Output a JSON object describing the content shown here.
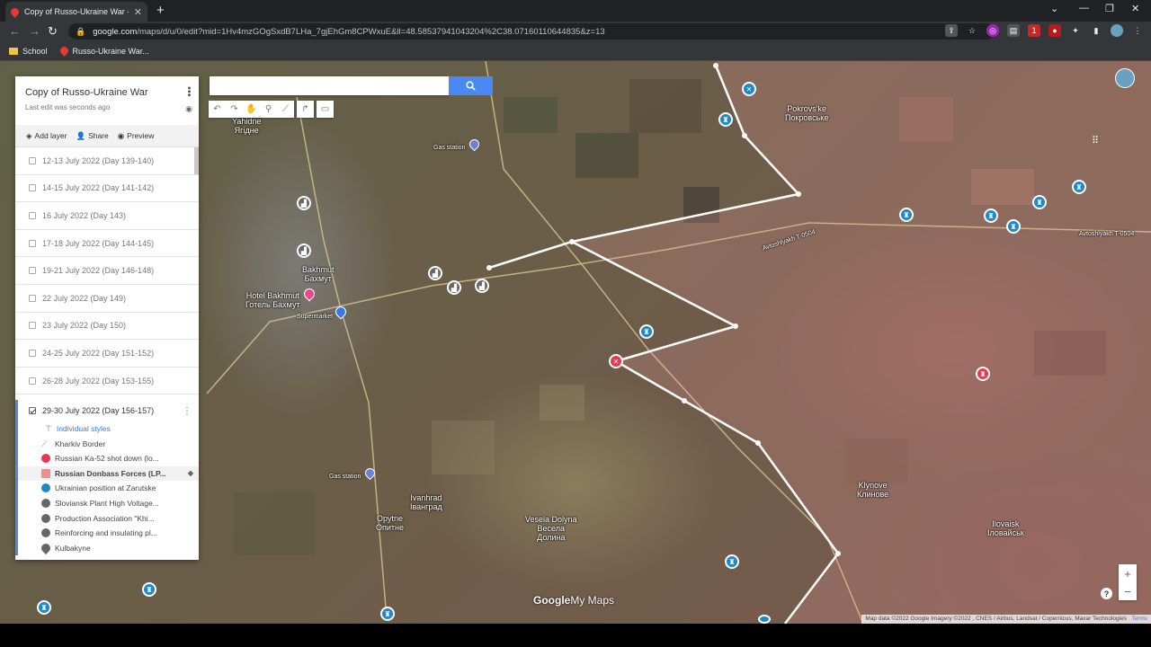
{
  "browser": {
    "tab_title": "Copy of Russo-Ukraine War - Go",
    "url_host": "google.com",
    "url_rest": "/maps/d/u/0/edit?mid=1Hv4mzGOgSxdB7LHa_7gjEhGm8CPWxuE&ll=48.58537941043204%2C38.07160110644835&z=13",
    "bookmarks": [
      "School",
      "Russo-Ukraine War..."
    ],
    "extension_badge": "1"
  },
  "panel": {
    "title": "Copy of Russo-Ukraine War",
    "subtitle": "Last edit was seconds ago",
    "actions": {
      "add_layer": "Add layer",
      "share": "Share",
      "preview": "Preview"
    },
    "layers": [
      "12-13 July 2022 (Day 139-140)",
      "14-15 July 2022 (Day 141-142)",
      "16 July 2022 (Day 143)",
      "17-18 July 2022 (Day 144-145)",
      "19-21 July 2022 (Day 146-148)",
      "22 July 2022 (Day 149)",
      "23 July 2022 (Day 150)",
      "24-25 July 2022 (Day 151-152)",
      "26-28 July 2022 (Day 153-155)"
    ],
    "active_layer": "29-30 July 2022 (Day 156-157)",
    "style_link": "Individual styles",
    "features": [
      {
        "label": "Kharkiv Border",
        "icon": "line-icon",
        "color": "#8a8a8a"
      },
      {
        "label": "Russian Ka-52 shot down (lo...",
        "icon": "crossed-circle-icon",
        "color": "#e53950"
      },
      {
        "label": "Russian Donbass Forces (LP...",
        "icon": "polygon-icon",
        "color": "#e89090"
      },
      {
        "label": "Ukrainian position at Zarutske",
        "icon": "fort-icon",
        "color": "#1e88c8"
      },
      {
        "label": "Sloviansk Plant High Voltage...",
        "icon": "factory-icon",
        "color": "#666666"
      },
      {
        "label": "Production Association \"Khi...",
        "icon": "factory-icon",
        "color": "#666666"
      },
      {
        "label": "Reinforcing and insulating pl...",
        "icon": "factory-icon",
        "color": "#666666"
      },
      {
        "label": "Kulbakyne",
        "icon": "pin-icon",
        "color": "#666666"
      }
    ]
  },
  "map": {
    "labels": {
      "yahidne": "Yahidne\nЯгідне",
      "bakhmut": "Bakhmut\nБахмут",
      "hotel": "Hotel Bakhmut\nГотель Бахмут",
      "supermarket": "Supermarket",
      "gas1": "Gas station",
      "gas2": "Gas station",
      "ivanhrad": "Ivanhrad\nІванград",
      "opytne": "Opytne\nОпитне",
      "vesela": "Vesela Dolyna\nВесела\nДолина",
      "klynove": "Klynove\nКлинове",
      "ilovaisk": "Ilovaisk\nІловайськ",
      "pokrovske": "Pokrovs'ke\nПокровське",
      "road1": "Avtoshlyakh T-0504",
      "road2": "Avtoshlyakh T-0504"
    },
    "branding": {
      "google": "Google",
      "mymaps": "My Maps"
    },
    "attribution": "Map data ©2022 Google Imagery ©2022 , CNES / Airbus, Landsat / Copernicus, Maxar Technologies",
    "terms": "Terms",
    "zoom_in": "+",
    "zoom_out": "−",
    "help": "?"
  },
  "colors": {
    "accent": "#4a89f3",
    "front_line": "#ffffff",
    "russian_area": "#f0a0a0",
    "ukrainian_marker": "#1e88c8",
    "russian_marker": "#e53950"
  }
}
